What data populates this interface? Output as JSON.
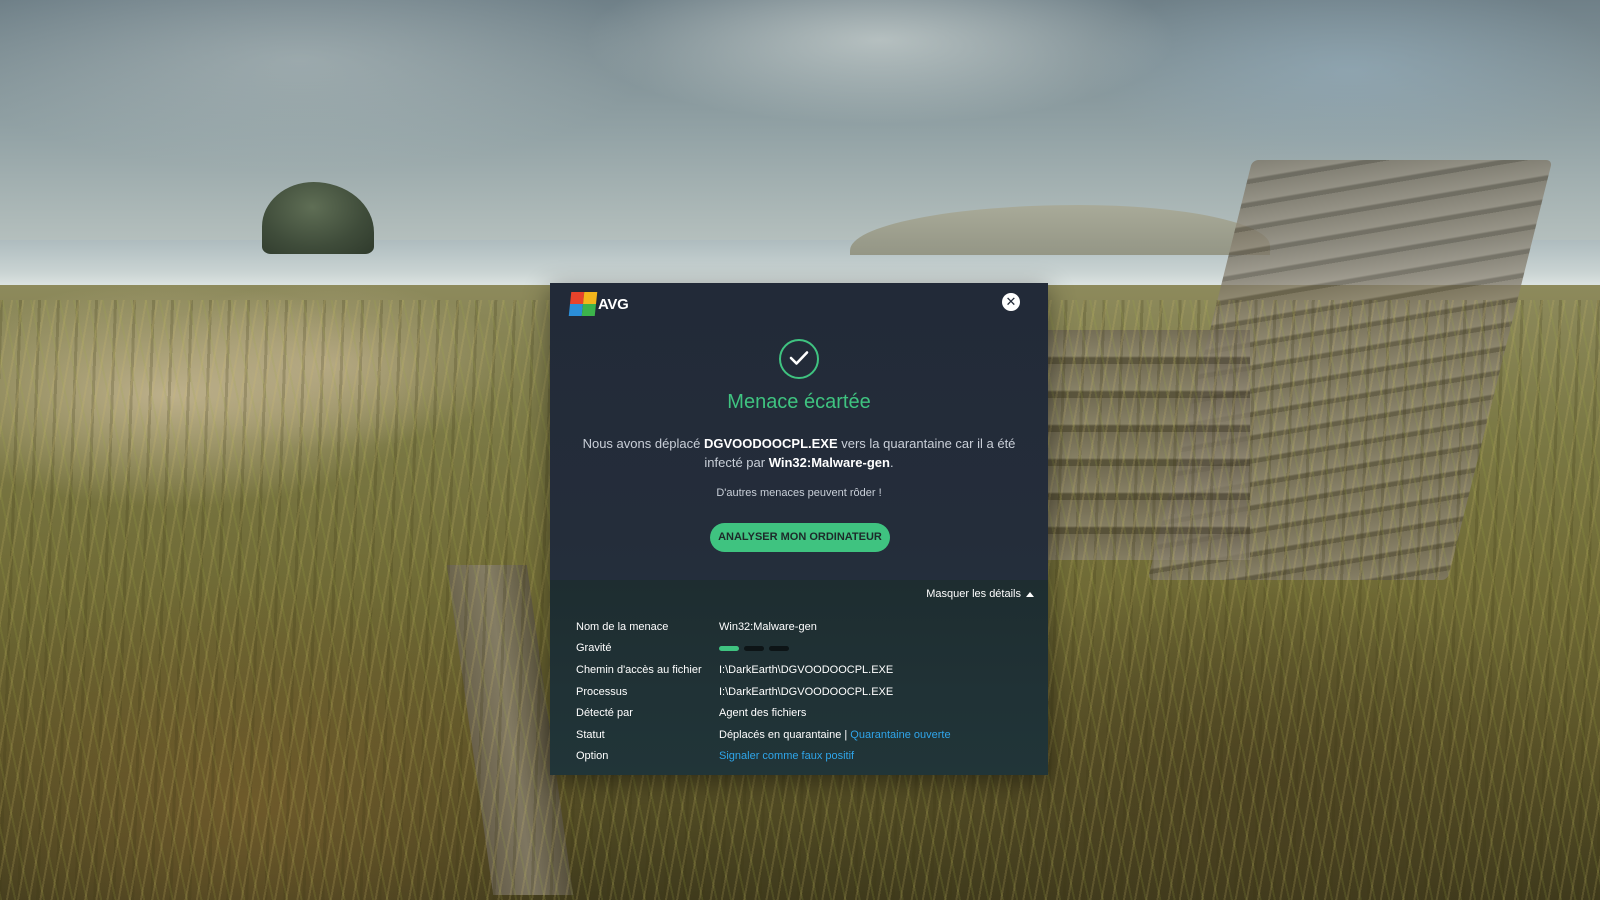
{
  "dialog": {
    "brand": "AVG",
    "close_symbol": "✕",
    "title": "Menace écartée",
    "message": {
      "part1": "Nous avons déplacé ",
      "file": "DGVOODOOCPL.EXE",
      "part2": " vers la quarantaine car il a été infecté par ",
      "threat": "Win32:Malware-gen",
      "part3": "."
    },
    "subtext": "D'autres menaces peuvent rôder !",
    "scan_button": "ANALYSER MON ORDINATEUR",
    "colors": {
      "accent": "#3fc380",
      "link": "#2fa5ea",
      "background": "#222a38"
    }
  },
  "details": {
    "toggle_label": "Masquer les détails",
    "rows": {
      "threat_name": {
        "label": "Nom de la menace",
        "value": "Win32:Malware-gen"
      },
      "severity": {
        "label": "Gravité",
        "level": 1,
        "max": 3
      },
      "file_path": {
        "label": "Chemin d'accès au fichier",
        "value": "I:\\DarkEarth\\DGVOODOOCPL.EXE"
      },
      "process": {
        "label": "Processus",
        "value": "I:\\DarkEarth\\DGVOODOOCPL.EXE"
      },
      "detected_by": {
        "label": "Détecté par",
        "value": "Agent des fichiers"
      },
      "status": {
        "label": "Statut",
        "value": "Déplacés en quarantaine |",
        "link": "Quarantaine ouverte"
      },
      "option": {
        "label": "Option",
        "link": "Signaler comme faux positif"
      }
    }
  },
  "icons": {
    "logo": "avg-logo-icon",
    "close": "close-icon",
    "success": "checkmark-icon",
    "toggle": "caret-up-icon"
  }
}
